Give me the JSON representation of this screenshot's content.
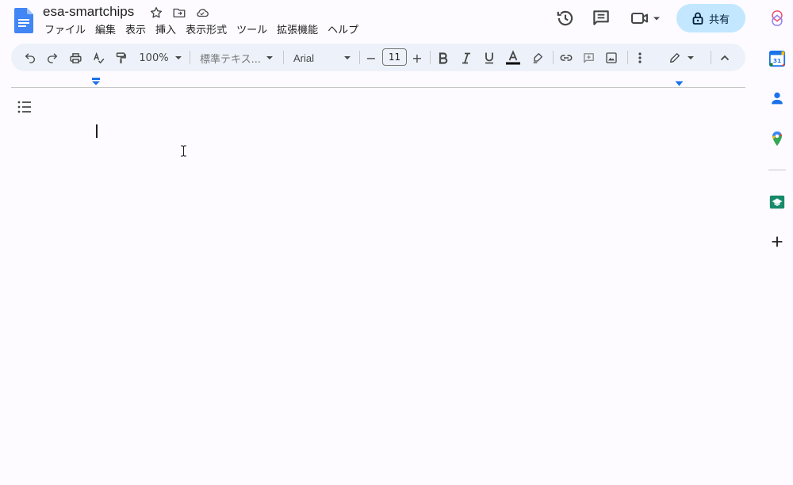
{
  "document": {
    "title": "esa-smartchips"
  },
  "menubar": {
    "items": [
      "ファイル",
      "編集",
      "表示",
      "挿入",
      "表示形式",
      "ツール",
      "拡張機能",
      "ヘルプ"
    ]
  },
  "share": {
    "label": "共有"
  },
  "toolbar": {
    "zoom": "100%",
    "style": "標準テキス...",
    "font": "Arial",
    "font_size": "11",
    "minus": "−",
    "plus": "+"
  },
  "colors": {
    "accent": "#1a73e8",
    "share_bg": "#c2e7ff",
    "toolbar_bg": "#edf2fa"
  }
}
